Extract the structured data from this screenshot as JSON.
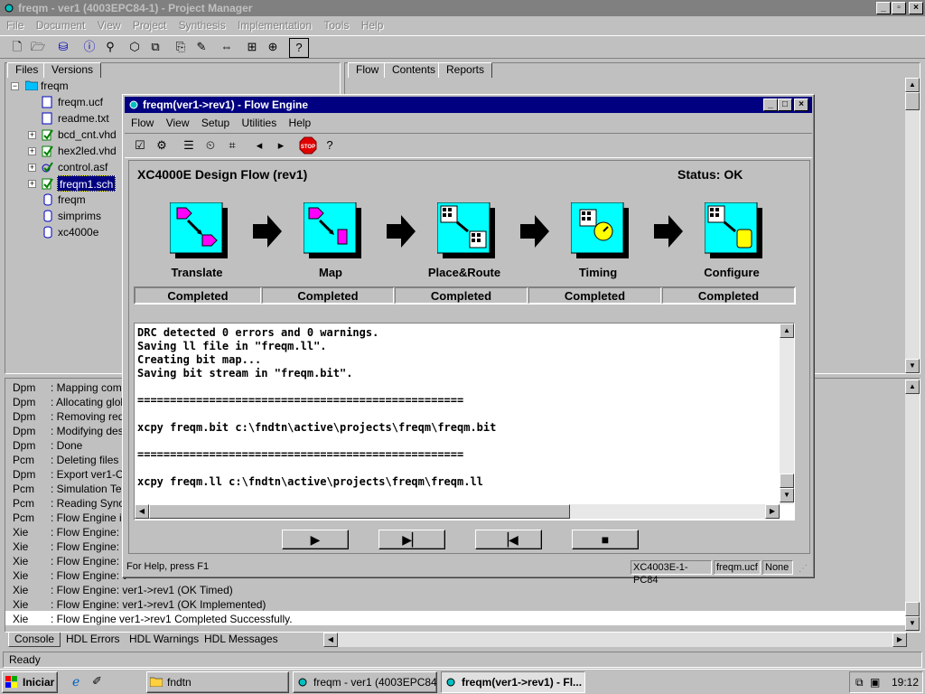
{
  "main_window": {
    "title": "freqm - ver1 (4003EPC84-1) - Project Manager",
    "menu": [
      "File",
      "Document",
      "View",
      "Project",
      "Synthesis",
      "Implementation",
      "Tools",
      "Help"
    ]
  },
  "left_panel": {
    "tabs": [
      "Files",
      "Versions"
    ],
    "root": "freqm",
    "items": [
      {
        "label": "freqm.ucf",
        "expand": false
      },
      {
        "label": "readme.txt",
        "expand": false
      },
      {
        "label": "bcd_cnt.vhd",
        "expand": true
      },
      {
        "label": "hex2led.vhd",
        "expand": true
      },
      {
        "label": "control.asf",
        "expand": true
      },
      {
        "label": "freqm1.sch",
        "expand": true,
        "selected": true
      },
      {
        "label": "freqm",
        "expand": false
      },
      {
        "label": "simprims",
        "expand": false
      },
      {
        "label": "xc4000e",
        "expand": false
      }
    ]
  },
  "right_panel": {
    "tabs": [
      "Flow",
      "Contents",
      "Reports"
    ]
  },
  "console": {
    "rows": [
      {
        "src": "Dpm",
        "msg": ": Mapping coml"
      },
      {
        "src": "Dpm",
        "msg": ": Allocating glob"
      },
      {
        "src": "Dpm",
        "msg": ": Removing red"
      },
      {
        "src": "Dpm",
        "msg": ": Modifying des"
      },
      {
        "src": "Dpm",
        "msg": ": Done"
      },
      {
        "src": "Pcm",
        "msg": ": Deleting files f"
      },
      {
        "src": "Dpm",
        "msg": ": Export ver1-Op"
      },
      {
        "src": "Pcm",
        "msg": ": Simulation Ter"
      },
      {
        "src": "Pcm",
        "msg": ": Reading Synop"
      },
      {
        "src": "Pcm",
        "msg": ": Flow Engine is"
      },
      {
        "src": "Xie",
        "msg": ": Flow Engine: v"
      },
      {
        "src": "Xie",
        "msg": ": Flow Engine: v"
      },
      {
        "src": "Xie",
        "msg": ": Flow Engine: v"
      },
      {
        "src": "Xie",
        "msg": ": Flow Engine: v"
      },
      {
        "src": "Xie",
        "msg": ": Flow Engine: ver1->rev1 (OK Timed)"
      },
      {
        "src": "Xie",
        "msg": ": Flow Engine: ver1->rev1 (OK Implemented)"
      },
      {
        "src": "Xie",
        "msg": ": Flow Engine ver1->rev1  Completed Successfully."
      }
    ],
    "tabs": [
      "Console",
      "HDL Errors",
      "HDL Warnings",
      "HDL Messages"
    ]
  },
  "status_bar": {
    "text": "Ready"
  },
  "flow_engine": {
    "title": "freqm(ver1->rev1) - Flow Engine",
    "menu": [
      "Flow",
      "View",
      "Setup",
      "Utilities",
      "Help"
    ],
    "design_title": "XC4000E Design Flow (rev1)",
    "status": "Status: OK",
    "stages": [
      {
        "label": "Translate",
        "status": "Completed"
      },
      {
        "label": "Map",
        "status": "Completed"
      },
      {
        "label": "Place&Route",
        "status": "Completed"
      },
      {
        "label": "Timing",
        "status": "Completed"
      },
      {
        "label": "Configure",
        "status": "Completed"
      }
    ],
    "log": "DRC detected 0 errors and 0 warnings.\nSaving ll file in \"freqm.ll\".\nCreating bit map...\nSaving bit stream in \"freqm.bit\".\n\n==================================================\n\nxcpy freqm.bit c:\\fndtn\\active\\projects\\freqm\\freqm.bit\n\n==================================================\n\nxcpy freqm.ll c:\\fndtn\\active\\projects\\freqm\\freqm.ll",
    "status_help": "For Help, press F1",
    "device": "XC4003E-1-PC84",
    "ucf": "freqm.ucf",
    "none": "None"
  },
  "taskbar": {
    "start": "Iniciar",
    "tasks": [
      "fndtn",
      "freqm - ver1 (4003EPC84-...",
      "freqm(ver1->rev1) - Fl..."
    ],
    "clock": "19:12"
  },
  "colors": {
    "titlebar_active": "#000080",
    "titlebar_inactive": "#808080",
    "selection": "#000080",
    "stage_icon": "#00ffff"
  }
}
